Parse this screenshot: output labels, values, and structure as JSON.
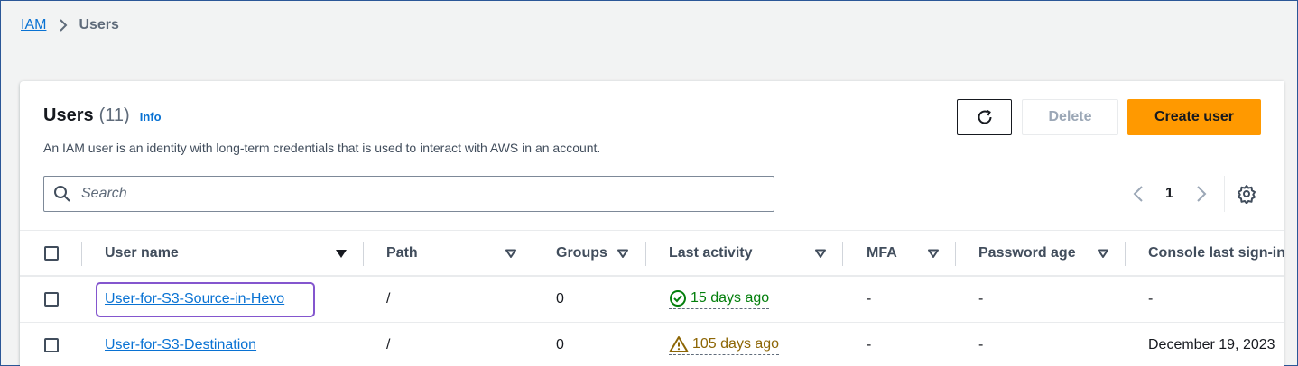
{
  "breadcrumb": {
    "root": "IAM",
    "current": "Users"
  },
  "header": {
    "title": "Users",
    "count": "(11)",
    "info": "Info",
    "description": "An IAM user is an identity with long-term credentials that is used to interact with AWS in an account."
  },
  "actions": {
    "refresh_icon": "refresh-icon",
    "delete_label": "Delete",
    "create_label": "Create user"
  },
  "search": {
    "placeholder": "Search",
    "value": ""
  },
  "pagination": {
    "current_page": "1"
  },
  "table": {
    "columns": [
      "User name",
      "Path",
      "Groups",
      "Last activity",
      "MFA",
      "Password age",
      "Console last sign-in"
    ],
    "rows": [
      {
        "user_name": "User-for-S3-Source-in-Hevo",
        "path": "/",
        "groups": "0",
        "last_activity": "15 days ago",
        "activity_status": "success",
        "mfa": "-",
        "password_age": "-",
        "console_last_sign_in": "-"
      },
      {
        "user_name": "User-for-S3-Destination",
        "path": "/",
        "groups": "0",
        "last_activity": "105 days ago",
        "activity_status": "warning",
        "mfa": "-",
        "password_age": "-",
        "console_last_sign_in": "December 19, 2023"
      }
    ]
  },
  "colors": {
    "primary_button": "#ff9900",
    "link": "#0972d3",
    "success": "#037f0c",
    "warning": "#8d6605",
    "focus": "#8456ce"
  }
}
